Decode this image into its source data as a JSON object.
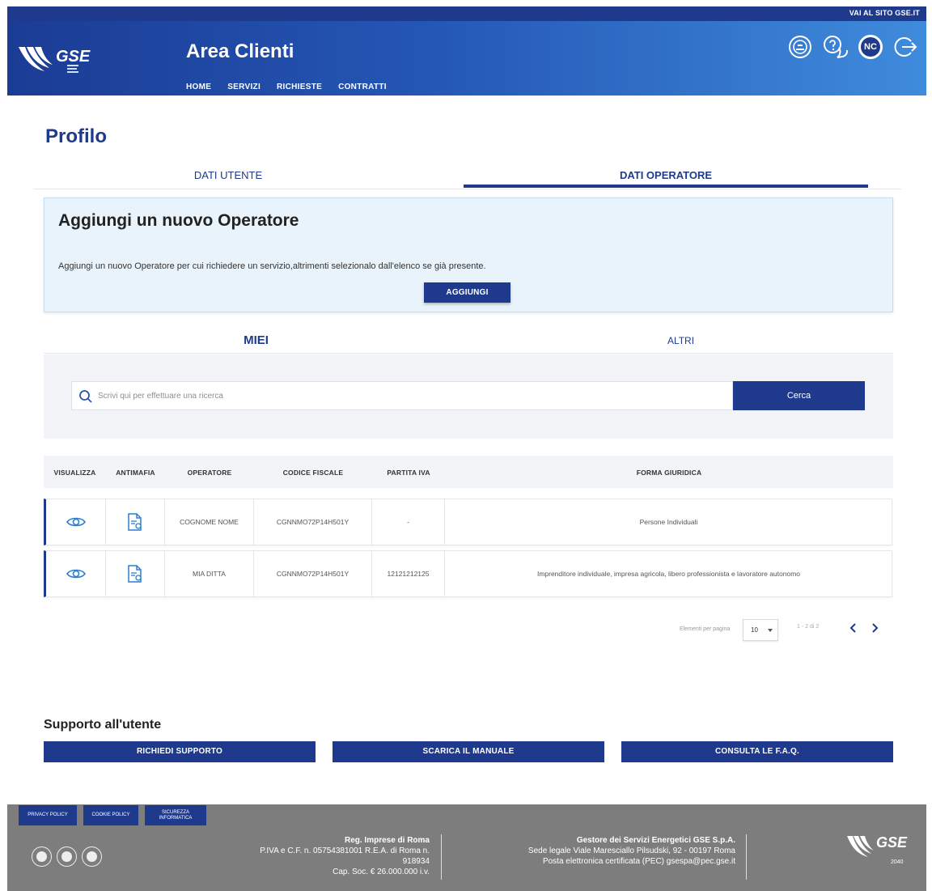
{
  "topbar": {
    "site_link": "VAI AL SITO GSE.IT"
  },
  "header": {
    "logo_text": "GSE",
    "title": "Area Clienti",
    "nav": [
      "HOME",
      "SERVIZI",
      "RICHIESTE",
      "CONTRATTI"
    ],
    "icons": [
      "notification-icon",
      "help-icon",
      "user-avatar",
      "logout-icon"
    ],
    "avatar_initials": "NC"
  },
  "page": {
    "title": "Profilo",
    "tabs": [
      "DATI UTENTE",
      "DATI OPERATORE"
    ],
    "active_tab": "DATI OPERATORE"
  },
  "add_operator": {
    "title": "Aggiungi un nuovo Operatore",
    "description": "Aggiungi un nuovo Operatore per cui richiedere un servizio,altrimenti selezionalo dall'elenco se già presente.",
    "button": "AGGIUNGI"
  },
  "subtabs": [
    "MIEI",
    "ALTRI"
  ],
  "search": {
    "placeholder": "Scrivi qui per effettuare una ricerca",
    "value": "",
    "button": "Cerca"
  },
  "table": {
    "columns": [
      "VISUALIZZA",
      "ANTIMAFIA",
      "OPERATORE",
      "CODICE FISCALE",
      "PARTITA IVA",
      "FORMA GIURIDICA"
    ],
    "rows": [
      {
        "operatore": "COGNOME NOME",
        "codice_fiscale": "CGNNMO72P14H501Y",
        "partita_iva": "-",
        "forma_giuridica": "Persone Individuali"
      },
      {
        "operatore": "MIA DITTA",
        "codice_fiscale": "CGNNMO72P14H501Y",
        "partita_iva": "12121212125",
        "forma_giuridica": "Imprenditore individuale, impresa agricola, libero professionista e lavoratore autonomo"
      }
    ]
  },
  "pagination": {
    "label": "Elementi per pagina",
    "per_page": "10",
    "count": "1 - 2 di 2"
  },
  "support": {
    "title": "Supporto all'utente",
    "buttons": [
      "RICHIEDI SUPPORTO",
      "SCARICA IL MANUALE",
      "CONSULTA LE F.A.Q."
    ]
  },
  "footer": {
    "links": [
      "PRIVACY POLICY",
      "COOKIE POLICY",
      "SICUREZZA INFORMATICA"
    ],
    "social": [
      "linkedin-icon",
      "twitter-icon",
      "youtube-icon"
    ],
    "reg": {
      "title": "Reg. Imprese di Roma",
      "line1": "P.IVA e C.F. n. 05754381001 R.E.A. di Roma n.",
      "line2": "918934",
      "line3": "Cap. Soc. € 26.000.000 i.v."
    },
    "company": {
      "title": "Gestore dei Servizi Energetici GSE S.p.A.",
      "line1": "Sede legale Viale Maresciallo Pilsudski, 92 - 00197 Roma",
      "line2": "Posta elettronica certificata (PEC) gsespa@pec.gse.it"
    },
    "logo_text": "GSE",
    "logo_sub": "2040"
  },
  "colors": {
    "brand": "#1f3a8c",
    "header_end": "#3f8bdc",
    "footer": "#7d7d7d",
    "card": "#e8f3fb"
  }
}
